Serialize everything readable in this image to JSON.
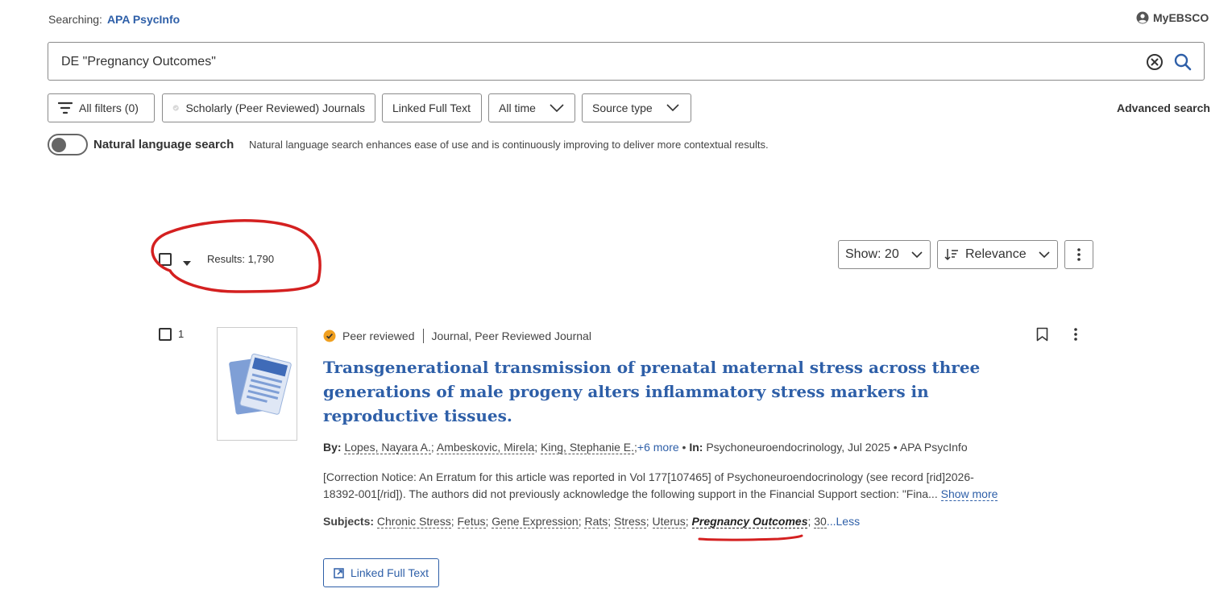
{
  "header": {
    "searching_label": "Searching:",
    "database": "APA PsycInfo",
    "account_label": "MyEBSCO"
  },
  "search": {
    "query": "DE \"Pregnancy Outcomes\""
  },
  "filters": {
    "all_filters": "All filters (0)",
    "scholarly": "Scholarly (Peer Reviewed) Journals",
    "linked_full_text": "Linked Full Text",
    "time": "All time",
    "source_type": "Source type",
    "advanced_search": "Advanced search"
  },
  "natural_language": {
    "label": "Natural language search",
    "description": "Natural language search enhances ease of use and is continuously improving to deliver more contextual results.",
    "enabled": false
  },
  "results_bar": {
    "results_text": "Results: 1,790",
    "show": "Show: 20",
    "sort": "Relevance"
  },
  "result": {
    "number": "1",
    "badge": "Peer reviewed",
    "doc_type": "Journal, Peer Reviewed Journal",
    "title": "Transgenerational transmission of prenatal maternal stress across three generations of male progeny alters inflammatory stress markers in reproductive tissues.",
    "by_label": "By:",
    "authors": [
      "Lopes, Nayara A.",
      "Ambeskovic, Mirela",
      "King, Stephanie E."
    ],
    "more_authors": "+6 more",
    "in_label": "In:",
    "source": "Psychoneuroendocrinology, Jul 2025",
    "database": "APA PsycInfo",
    "abstract_line1": "[Correction Notice: An Erratum for this article was reported in Vol 177[107465] of Psychoneuroendocrinology (see record [rid]2026-",
    "abstract_line2": "18392-001[/rid]). The authors did not previously acknowledge the following support in the Financial Support section: \"Fina...",
    "show_more": "Show more",
    "subjects_label": "Subjects:",
    "subjects": [
      "Chronic Stress",
      "Fetus",
      "Gene Expression",
      "Rats",
      "Stress",
      "Uterus"
    ],
    "highlighted_subject": "Pregnancy Outcomes",
    "subjects_more": "30",
    "less": "...Less",
    "full_text_button": "Linked Full Text"
  },
  "colors": {
    "link": "#2e5fa8",
    "annotation": "#d42020",
    "peer_badge": "#f0a020"
  }
}
